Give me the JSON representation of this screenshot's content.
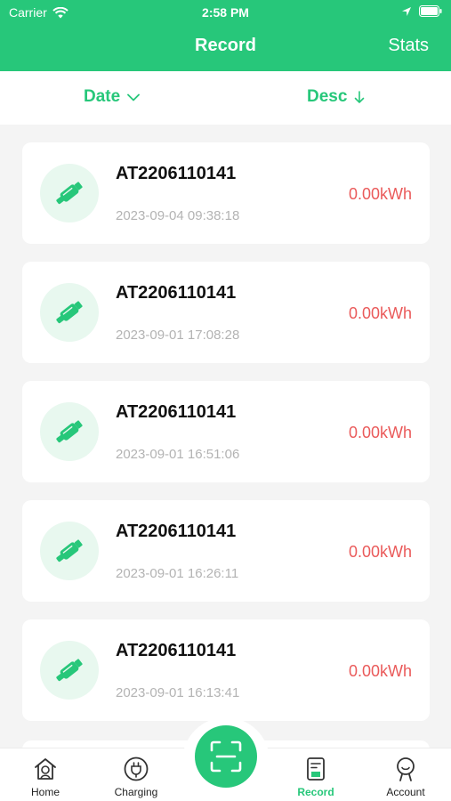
{
  "status_bar": {
    "carrier": "Carrier",
    "time": "2:58 PM"
  },
  "nav": {
    "title": "Record",
    "stats_label": "Stats"
  },
  "filters": {
    "sort_field": "Date",
    "sort_order": "Desc"
  },
  "records": [
    {
      "device": "AT2206110141",
      "datetime": "2023-09-04 09:38:18",
      "energy": "0.00kWh"
    },
    {
      "device": "AT2206110141",
      "datetime": "2023-09-01 17:08:28",
      "energy": "0.00kWh"
    },
    {
      "device": "AT2206110141",
      "datetime": "2023-09-01 16:51:06",
      "energy": "0.00kWh"
    },
    {
      "device": "AT2206110141",
      "datetime": "2023-09-01 16:26:11",
      "energy": "0.00kWh"
    },
    {
      "device": "AT2206110141",
      "datetime": "2023-09-01 16:13:41",
      "energy": "0.00kWh"
    }
  ],
  "tabs": [
    {
      "label": "Home",
      "icon": "home-icon",
      "active": false
    },
    {
      "label": "Charging",
      "icon": "plug-icon",
      "active": false
    },
    {
      "label": "Record",
      "icon": "record-icon",
      "active": true
    },
    {
      "label": "Account",
      "icon": "account-icon",
      "active": false
    }
  ],
  "colors": {
    "brand": "#27c77a",
    "energy": "#ea5a5a",
    "date_text": "#b3b3b3",
    "background": "#f4f4f4"
  }
}
